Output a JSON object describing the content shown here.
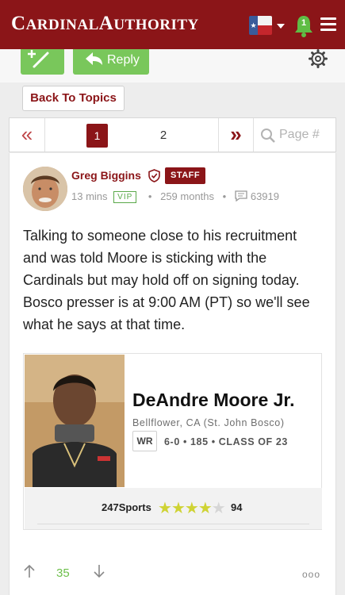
{
  "header": {
    "logo_first_letter": "C",
    "logo_part1": "ARDINAL",
    "logo_second_letter": "A",
    "logo_part2": "UTHORITY",
    "notifications_count": "1"
  },
  "actions": {
    "reply_label": "Reply",
    "back_label": "Back To Topics"
  },
  "pagination": {
    "prev_symbol": "«",
    "next_symbol": "»",
    "pages": [
      "1",
      "2"
    ],
    "current_page": "1",
    "page_placeholder": "Page #"
  },
  "post": {
    "author": "Greg Biggins",
    "badge": "STAFF",
    "time_ago": "13 mins",
    "vip": "VIP",
    "tenure": "259 months",
    "post_count": "63919",
    "body": "Talking to someone close to his recruitment and was told Moore is sticking with the Cardinals but may hold off on signing today. Bosco presser is at 9:00 AM (PT) so we'll see what he says at that time."
  },
  "recruit": {
    "name": "DeAndre Moore Jr.",
    "school": "Bellflower, CA (St. John Bosco)",
    "position": "WR",
    "stats": "6-0 • 185 • CLASS OF 23",
    "rating_source": "247Sports",
    "stars_filled": 4,
    "stars_total": 5,
    "rating": "94"
  },
  "reactions": {
    "votes": "35",
    "more": "ooo"
  },
  "colors": {
    "brand": "#8b1518",
    "accent_green": "#79c75b",
    "star": "#cfd334"
  }
}
